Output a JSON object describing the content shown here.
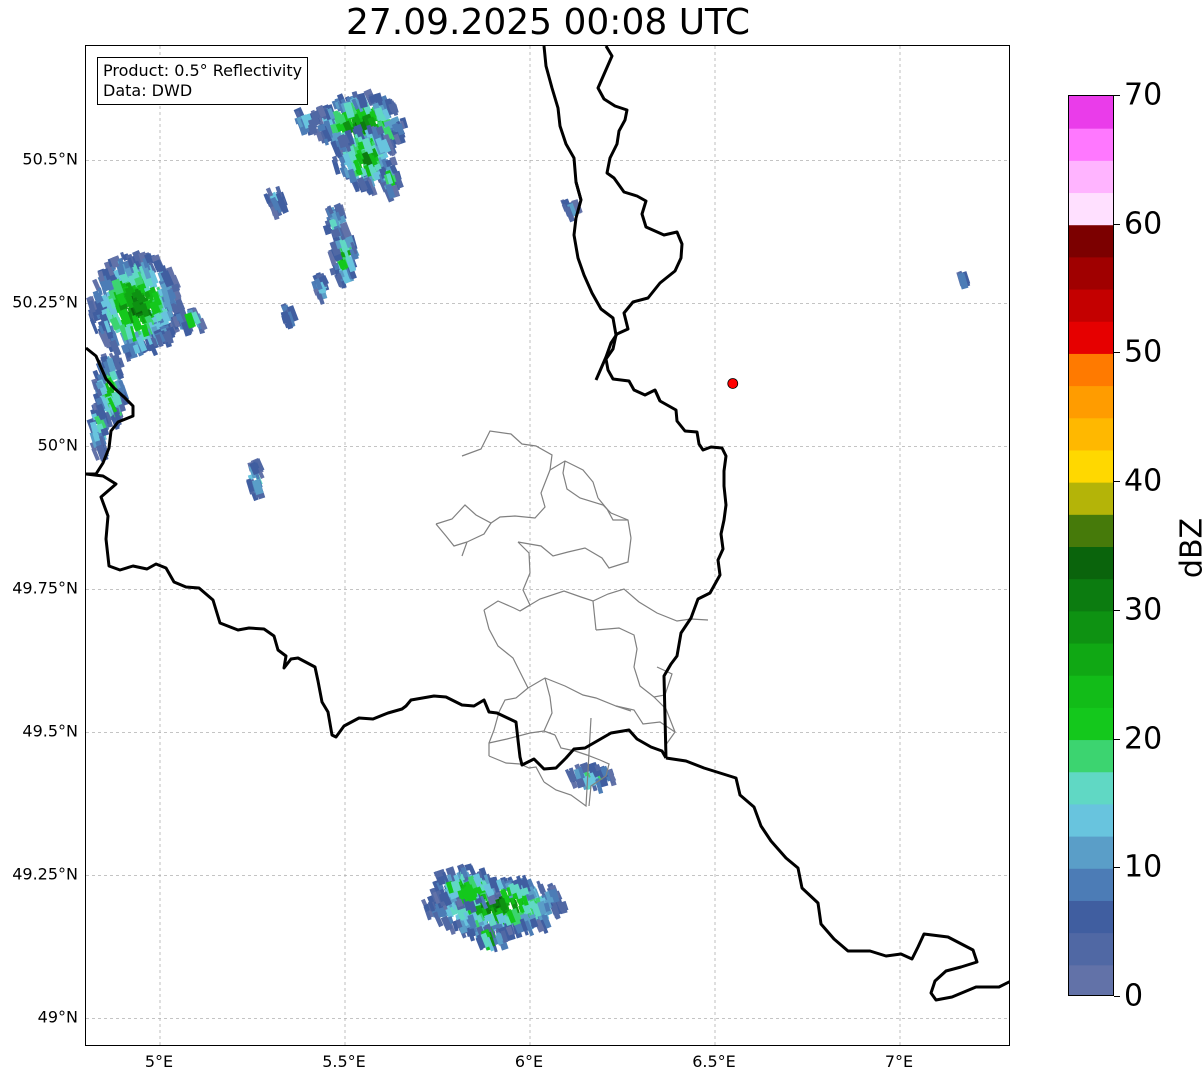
{
  "title": "27.09.2025 00:08 UTC",
  "info_box": {
    "product": "Product: 0.5° Reflectivity",
    "source": "Data: DWD"
  },
  "map": {
    "lon_range": [
      4.8,
      7.3
    ],
    "lat_range": [
      48.95,
      50.7
    ],
    "lat_labels": [
      {
        "value": 50.5,
        "text": "50.5°N"
      },
      {
        "value": 50.25,
        "text": "50.25°N"
      },
      {
        "value": 50.0,
        "text": "50°N"
      },
      {
        "value": 49.75,
        "text": "49.75°N"
      },
      {
        "value": 49.5,
        "text": "49.5°N"
      },
      {
        "value": 49.25,
        "text": "49.25°N"
      },
      {
        "value": 49.0,
        "text": "49°N"
      }
    ],
    "lon_labels": [
      {
        "value": 5.0,
        "text": "5°E"
      },
      {
        "value": 5.5,
        "text": "5.5°E"
      },
      {
        "value": 6.0,
        "text": "6°E"
      },
      {
        "value": 6.5,
        "text": "6.5°E"
      },
      {
        "value": 7.0,
        "text": "7°E"
      }
    ],
    "radar_site": {
      "lon": 6.548,
      "lat": 50.11,
      "color": "#ff0000"
    },
    "colors": {
      "gridline": "#b0b0b0",
      "border": "#000000",
      "admin": "#808080"
    }
  },
  "colorbar": {
    "label": "dBZ",
    "min": 0,
    "max": 70,
    "ticks": [
      "0",
      "10",
      "20",
      "30",
      "40",
      "50",
      "60",
      "70"
    ],
    "colors": [
      "#6272a8",
      "#5068a4",
      "#405ea0",
      "#4c7cb6",
      "#5a9ec8",
      "#68c4de",
      "#60d8c4",
      "#3cd470",
      "#14c81c",
      "#12bc18",
      "#10a814",
      "#0e9212",
      "#0c7c10",
      "#0a640c",
      "#467a0a",
      "#b4b408",
      "#ffd800",
      "#ffb800",
      "#ff9c00",
      "#ff7a00",
      "#e60000",
      "#c40000",
      "#a00000",
      "#7c0000",
      "#ffe0ff",
      "#ffb4ff",
      "#ff78ff",
      "#ea3cea"
    ]
  }
}
